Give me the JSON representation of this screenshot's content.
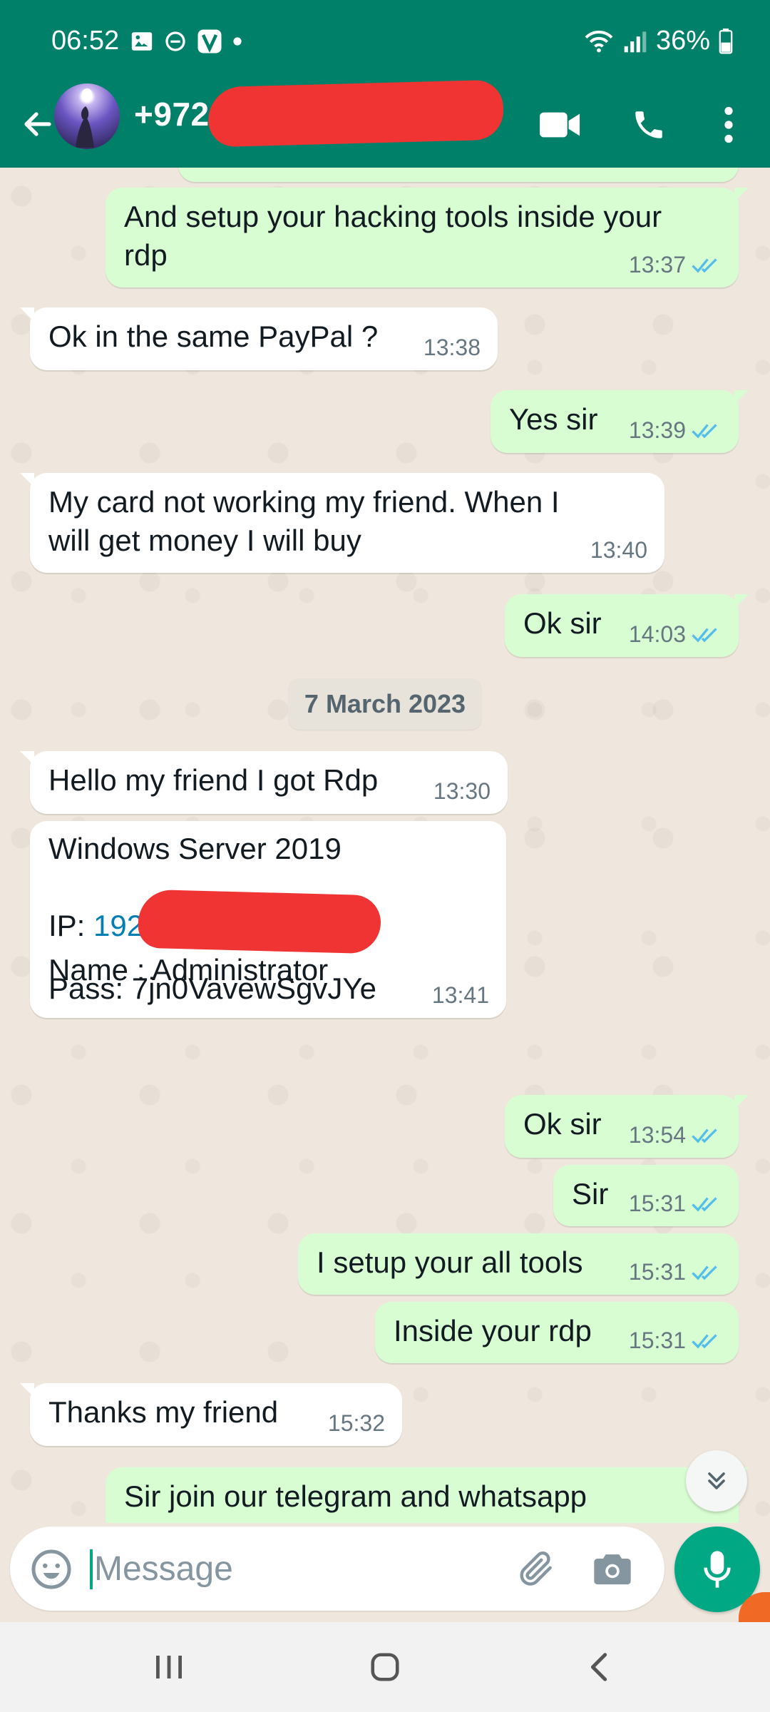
{
  "status_bar": {
    "time": "06:52",
    "battery": "36%"
  },
  "header": {
    "contact_name": "+972",
    "colors": {
      "bar": "#008069"
    }
  },
  "messages": [
    {
      "dir": "out",
      "text": "And setup your hacking tools inside your\nrdp",
      "time": "13:37",
      "ticks": "read"
    },
    {
      "dir": "in",
      "text": "Ok in the same PayPal ?",
      "time": "13:38"
    },
    {
      "dir": "out",
      "text": "Yes sir",
      "time": "13:39",
      "ticks": "read"
    },
    {
      "dir": "in",
      "text": "My card not working my friend. When I\nwill get money I will buy",
      "time": "13:40"
    },
    {
      "dir": "out",
      "text": "Ok sir",
      "time": "14:03",
      "ticks": "read"
    },
    {
      "dir": "date",
      "text": "7 March 2023"
    },
    {
      "dir": "in",
      "text": "Hello my friend I got Rdp",
      "time": "13:30"
    },
    {
      "dir": "in",
      "server_line": "Windows Server 2019",
      "ip_label": "IP: ",
      "ip_value": "192",
      "name_line": "Name : Administrator",
      "pass_line": "Pass: 7jn0VavewSgvJYe",
      "time": "13:41"
    },
    {
      "dir": "out",
      "text": "Ok sir",
      "time": "13:54",
      "ticks": "read"
    },
    {
      "dir": "out",
      "text": "Sir",
      "time": "15:31",
      "ticks": "read"
    },
    {
      "dir": "out",
      "text": "I setup your all tools",
      "time": "15:31",
      "ticks": "read"
    },
    {
      "dir": "out",
      "text": "Inside your rdp",
      "time": "15:31",
      "ticks": "read"
    },
    {
      "dir": "in",
      "text": "Thanks my friend",
      "time": "15:32"
    },
    {
      "dir": "out",
      "text": "Sir join our telegram and whatsapp"
    }
  ],
  "composer": {
    "placeholder": "Message"
  },
  "colors": {
    "accent": "#00a884",
    "outgoing_bubble": "#d9fdd3",
    "incoming_bubble": "#ffffff",
    "read_ticks": "#53bdeb",
    "redaction": "#f03434"
  }
}
